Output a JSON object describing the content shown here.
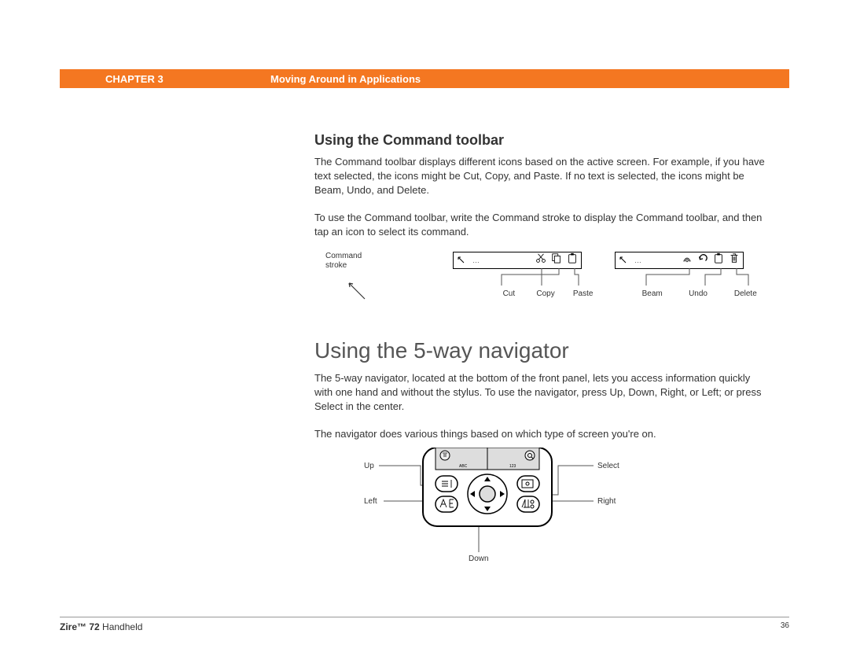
{
  "header": {
    "chapter": "CHAPTER 3",
    "title": "Moving Around in Applications"
  },
  "section1": {
    "heading": "Using the Command toolbar",
    "p1": "The Command toolbar displays different icons based on the active screen. For example, if you have text selected, the icons might be Cut, Copy, and Paste. If no text is selected, the icons might be Beam, Undo, and Delete.",
    "p2": "To use the Command toolbar, write the Command stroke to display the Command toolbar, and then tap an icon to select its command.",
    "stroke_label1": "Command",
    "stroke_label2": "stroke",
    "labels_left": {
      "cut": "Cut",
      "copy": "Copy",
      "paste": "Paste"
    },
    "labels_right": {
      "beam": "Beam",
      "undo": "Undo",
      "delete": "Delete"
    }
  },
  "section2": {
    "heading": "Using the 5-way navigator",
    "p1": "The 5-way navigator, located at the bottom of the front panel, lets you access information quickly with one hand and without the stylus. To use the navigator, press Up, Down, Right, or Left; or press Select in the center.",
    "p2": "The navigator does various things based on which type of screen you're on.",
    "labels": {
      "up": "Up",
      "down": "Down",
      "left": "Left",
      "right": "Right",
      "select": "Select"
    },
    "screen": {
      "abc": "ABC",
      "num": "123"
    }
  },
  "footer": {
    "product_bold": "Zire™ 72",
    "product_rest": " Handheld",
    "page": "36"
  }
}
